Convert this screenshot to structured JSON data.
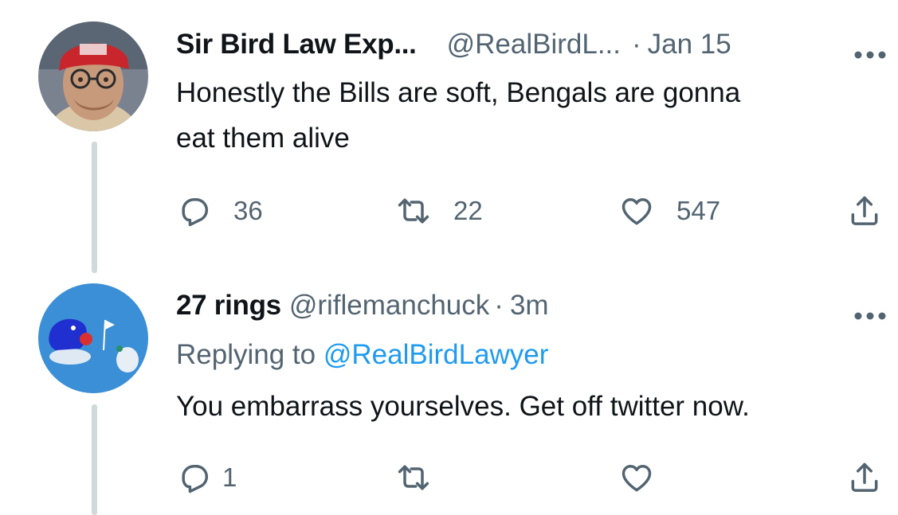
{
  "tweets": [
    {
      "display_name": "Sir Bird Law Exp...",
      "handle": "@RealBirdL...",
      "separator": "·",
      "time": "Jan 15",
      "text_lines": [
        "Honestly the Bills are soft, Bengals are gonna",
        "eat them alive"
      ],
      "counts": {
        "replies": "36",
        "retweets": "22",
        "likes": "547"
      }
    },
    {
      "display_name": "27 rings",
      "handle": "@riflemanchuck",
      "separator": "·",
      "time": "3m",
      "replying_to_label": "Replying to",
      "replying_to_handle": "@RealBirdLawyer",
      "text": "You embarrass yourselves. Get off twitter now.",
      "counts": {
        "replies": "1"
      }
    }
  ],
  "icons": {
    "reply": "reply-icon",
    "retweet": "retweet-icon",
    "like": "heart-icon",
    "share": "share-icon",
    "more": "more-icon"
  },
  "colors": {
    "text_primary": "#0f1419",
    "text_secondary": "#536471",
    "link": "#1d9bf0",
    "thread_line": "#cfd9de"
  }
}
